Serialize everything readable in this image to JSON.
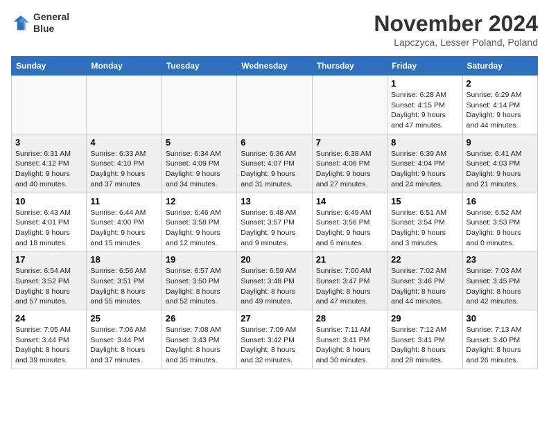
{
  "header": {
    "logo_line1": "General",
    "logo_line2": "Blue",
    "month": "November 2024",
    "location": "Lapczyca, Lesser Poland, Poland"
  },
  "weekdays": [
    "Sunday",
    "Monday",
    "Tuesday",
    "Wednesday",
    "Thursday",
    "Friday",
    "Saturday"
  ],
  "weeks": [
    {
      "shaded": false,
      "days": [
        {
          "date": "",
          "info": ""
        },
        {
          "date": "",
          "info": ""
        },
        {
          "date": "",
          "info": ""
        },
        {
          "date": "",
          "info": ""
        },
        {
          "date": "",
          "info": ""
        },
        {
          "date": "1",
          "info": "Sunrise: 6:28 AM\nSunset: 4:15 PM\nDaylight: 9 hours\nand 47 minutes."
        },
        {
          "date": "2",
          "info": "Sunrise: 6:29 AM\nSunset: 4:14 PM\nDaylight: 9 hours\nand 44 minutes."
        }
      ]
    },
    {
      "shaded": true,
      "days": [
        {
          "date": "3",
          "info": "Sunrise: 6:31 AM\nSunset: 4:12 PM\nDaylight: 9 hours\nand 40 minutes."
        },
        {
          "date": "4",
          "info": "Sunrise: 6:33 AM\nSunset: 4:10 PM\nDaylight: 9 hours\nand 37 minutes."
        },
        {
          "date": "5",
          "info": "Sunrise: 6:34 AM\nSunset: 4:09 PM\nDaylight: 9 hours\nand 34 minutes."
        },
        {
          "date": "6",
          "info": "Sunrise: 6:36 AM\nSunset: 4:07 PM\nDaylight: 9 hours\nand 31 minutes."
        },
        {
          "date": "7",
          "info": "Sunrise: 6:38 AM\nSunset: 4:06 PM\nDaylight: 9 hours\nand 27 minutes."
        },
        {
          "date": "8",
          "info": "Sunrise: 6:39 AM\nSunset: 4:04 PM\nDaylight: 9 hours\nand 24 minutes."
        },
        {
          "date": "9",
          "info": "Sunrise: 6:41 AM\nSunset: 4:03 PM\nDaylight: 9 hours\nand 21 minutes."
        }
      ]
    },
    {
      "shaded": false,
      "days": [
        {
          "date": "10",
          "info": "Sunrise: 6:43 AM\nSunset: 4:01 PM\nDaylight: 9 hours\nand 18 minutes."
        },
        {
          "date": "11",
          "info": "Sunrise: 6:44 AM\nSunset: 4:00 PM\nDaylight: 9 hours\nand 15 minutes."
        },
        {
          "date": "12",
          "info": "Sunrise: 6:46 AM\nSunset: 3:58 PM\nDaylight: 9 hours\nand 12 minutes."
        },
        {
          "date": "13",
          "info": "Sunrise: 6:48 AM\nSunset: 3:57 PM\nDaylight: 9 hours\nand 9 minutes."
        },
        {
          "date": "14",
          "info": "Sunrise: 6:49 AM\nSunset: 3:56 PM\nDaylight: 9 hours\nand 6 minutes."
        },
        {
          "date": "15",
          "info": "Sunrise: 6:51 AM\nSunset: 3:54 PM\nDaylight: 9 hours\nand 3 minutes."
        },
        {
          "date": "16",
          "info": "Sunrise: 6:52 AM\nSunset: 3:53 PM\nDaylight: 9 hours\nand 0 minutes."
        }
      ]
    },
    {
      "shaded": true,
      "days": [
        {
          "date": "17",
          "info": "Sunrise: 6:54 AM\nSunset: 3:52 PM\nDaylight: 8 hours\nand 57 minutes."
        },
        {
          "date": "18",
          "info": "Sunrise: 6:56 AM\nSunset: 3:51 PM\nDaylight: 8 hours\nand 55 minutes."
        },
        {
          "date": "19",
          "info": "Sunrise: 6:57 AM\nSunset: 3:50 PM\nDaylight: 8 hours\nand 52 minutes."
        },
        {
          "date": "20",
          "info": "Sunrise: 6:59 AM\nSunset: 3:48 PM\nDaylight: 8 hours\nand 49 minutes."
        },
        {
          "date": "21",
          "info": "Sunrise: 7:00 AM\nSunset: 3:47 PM\nDaylight: 8 hours\nand 47 minutes."
        },
        {
          "date": "22",
          "info": "Sunrise: 7:02 AM\nSunset: 3:46 PM\nDaylight: 8 hours\nand 44 minutes."
        },
        {
          "date": "23",
          "info": "Sunrise: 7:03 AM\nSunset: 3:45 PM\nDaylight: 8 hours\nand 42 minutes."
        }
      ]
    },
    {
      "shaded": false,
      "days": [
        {
          "date": "24",
          "info": "Sunrise: 7:05 AM\nSunset: 3:44 PM\nDaylight: 8 hours\nand 39 minutes."
        },
        {
          "date": "25",
          "info": "Sunrise: 7:06 AM\nSunset: 3:44 PM\nDaylight: 8 hours\nand 37 minutes."
        },
        {
          "date": "26",
          "info": "Sunrise: 7:08 AM\nSunset: 3:43 PM\nDaylight: 8 hours\nand 35 minutes."
        },
        {
          "date": "27",
          "info": "Sunrise: 7:09 AM\nSunset: 3:42 PM\nDaylight: 8 hours\nand 32 minutes."
        },
        {
          "date": "28",
          "info": "Sunrise: 7:11 AM\nSunset: 3:41 PM\nDaylight: 8 hours\nand 30 minutes."
        },
        {
          "date": "29",
          "info": "Sunrise: 7:12 AM\nSunset: 3:41 PM\nDaylight: 8 hours\nand 28 minutes."
        },
        {
          "date": "30",
          "info": "Sunrise: 7:13 AM\nSunset: 3:40 PM\nDaylight: 8 hours\nand 26 minutes."
        }
      ]
    }
  ]
}
